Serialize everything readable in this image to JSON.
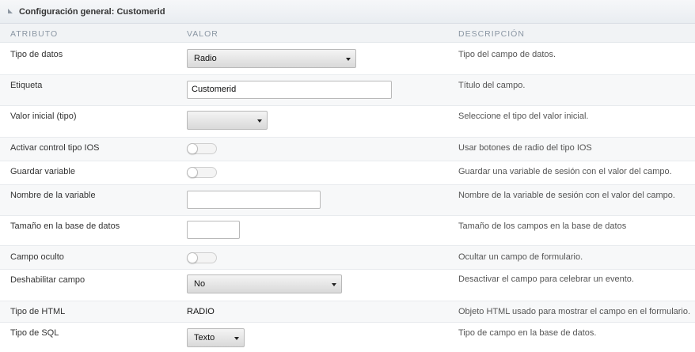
{
  "panel": {
    "title": "Configuración general: Customerid"
  },
  "columns": {
    "attribute": "ATRIBUTO",
    "value": "VALOR",
    "description": "DESCRIPCIÓN"
  },
  "rows": [
    {
      "label": "Tipo de datos",
      "control": "select",
      "value": "Radio",
      "description": "Tipo del campo de datos."
    },
    {
      "label": "Etiqueta",
      "control": "text",
      "value": "Customerid",
      "description": "Título del campo."
    },
    {
      "label": "Valor inicial (tipo)",
      "control": "select",
      "value": "",
      "description": "Seleccione el tipo del valor inicial."
    },
    {
      "label": "Activar control tipo IOS",
      "control": "toggle",
      "value": "off",
      "description": "Usar botones de radio del tipo IOS"
    },
    {
      "label": "Guardar variable",
      "control": "toggle",
      "value": "off",
      "description": "Guardar una variable de sesión con el valor del campo."
    },
    {
      "label": "Nombre de la variable",
      "control": "text",
      "value": "",
      "description": "Nombre de la variable de sesión con el valor del campo."
    },
    {
      "label": "Tamaño en la base de datos",
      "control": "text",
      "value": "",
      "description": "Tamaño de los campos en la base de datos"
    },
    {
      "label": "Campo oculto",
      "control": "toggle",
      "value": "off",
      "description": "Ocultar un campo de formulario."
    },
    {
      "label": "Deshabilitar campo",
      "control": "select",
      "value": "No",
      "description": "Desactivar el campo para celebrar un evento."
    },
    {
      "label": "Tipo de HTML",
      "control": "static",
      "value": "RADIO",
      "description": "Objeto HTML usado para mostrar el campo en el formulario."
    },
    {
      "label": "Tipo de SQL",
      "control": "select",
      "value": "Texto",
      "description": "Tipo de campo en la base de datos."
    }
  ]
}
